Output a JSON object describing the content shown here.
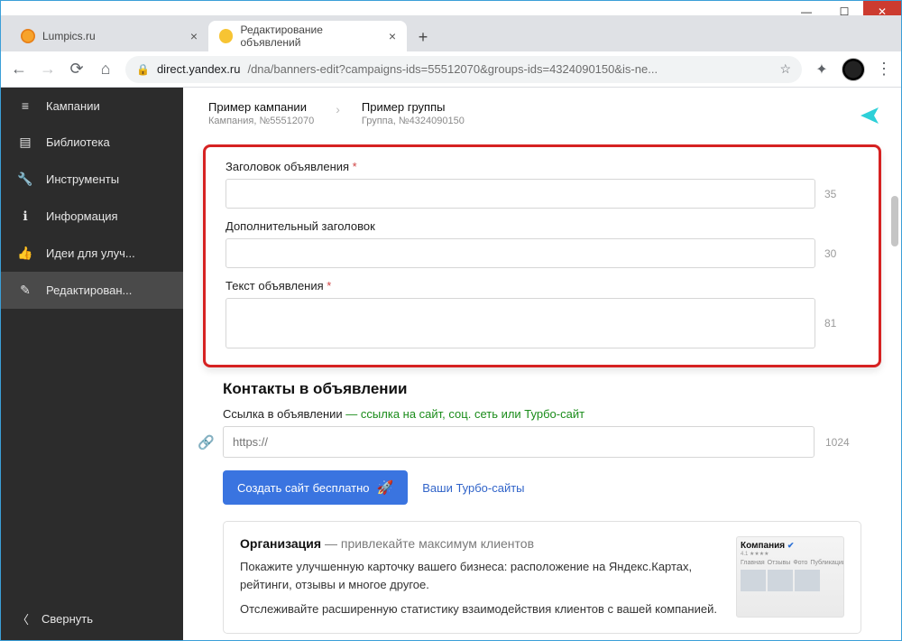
{
  "window": {
    "min": "—",
    "max": "☐",
    "close": "✕"
  },
  "tabs": [
    {
      "title": "Lumpics.ru",
      "active": false
    },
    {
      "title": "Редактирование объявлений",
      "active": true
    }
  ],
  "urlbar": {
    "domain": "direct.yandex.ru",
    "path": "/dna/banners-edit?campaigns-ids=55512070&groups-ids=4324090150&is-ne..."
  },
  "sidebar": {
    "items": [
      {
        "icon": "≡",
        "label": "Кампании"
      },
      {
        "icon": "▤",
        "label": "Библиотека"
      },
      {
        "icon": "🔧",
        "label": "Инструменты"
      },
      {
        "icon": "ℹ",
        "label": "Информация"
      },
      {
        "icon": "👍",
        "label": "Идеи для улуч..."
      },
      {
        "icon": "✎",
        "label": "Редактирован..."
      }
    ],
    "collapse": "Свернуть"
  },
  "breadcrumb": {
    "campaign": {
      "title": "Пример кампании",
      "sub": "Кампания, №55512070"
    },
    "group": {
      "title": "Пример группы",
      "sub": "Группа, №4324090150"
    }
  },
  "form": {
    "headline": {
      "label": "Заголовок объявления",
      "counter": "35"
    },
    "subhead": {
      "label": "Дополнительный заголовок",
      "counter": "30"
    },
    "body": {
      "label": "Текст объявления",
      "counter": "81"
    }
  },
  "contacts": {
    "heading": "Контакты в объявлении",
    "link_label": "Ссылка в объявлении",
    "link_hint": " — ссылка на сайт, соц. сеть или Турбо-сайт",
    "url_placeholder": "https://",
    "url_counter": "1024",
    "create_btn": "Создать сайт бесплатно",
    "turbo_link": "Ваши Турбо-сайты"
  },
  "org": {
    "title": "Организация",
    "subtitle": " — привлекайте максимум клиентов",
    "desc1": "Покажите улучшенную карточку вашего бизнеса: расположение на Яндекс.Картах, рейтинги, отзывы и многое другое.",
    "desc2": "Отслеживайте расширенную статистику взаимодействия клиентов с вашей компанией.",
    "preview_title": "Компания",
    "preview_tabs": [
      "Главная",
      "Отзывы",
      "Фото",
      "Публикации"
    ]
  }
}
